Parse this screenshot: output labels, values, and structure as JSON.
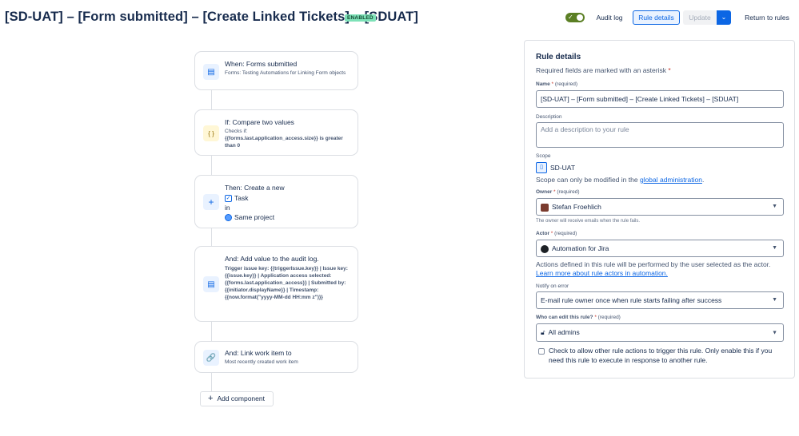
{
  "header": {
    "title": "[SD-UAT] – [Form submitted] – [Create Linked Tickets] – [SDUAT]",
    "status_badge": "ENABLED",
    "audit_log_label": "Audit log",
    "rule_details_label": "Rule details",
    "update_label": "Update",
    "return_label": "Return to rules"
  },
  "flow": {
    "trigger": {
      "title": "When: Forms submitted",
      "subtitle": "Forms: Testing Automations for Linking Form objects"
    },
    "condition": {
      "title": "If: Compare two values",
      "subtitle_prefix": "Checks if:",
      "subtitle_detail": "{{forms.last.application_access.size}} is greater than 0"
    },
    "action_create": {
      "title": "Then: Create a new",
      "issue_type": "Task",
      "in_label": "in",
      "project": "Same project"
    },
    "action_audit": {
      "title": "And: Add value to the audit log.",
      "detail": "Trigger issue key: {{triggerIssue.key}} | Issue key: {{issue.key}} | Application access selected: {{forms.last.application_access}} | Submitted by: {{initiator.displayName}} | Timestamp: {{now.format(\"yyyy-MM-dd HH:mm z\")}}"
    },
    "action_link": {
      "title": "And: Link work item to",
      "subtitle": "Most recently created work item"
    },
    "add_component_label": "Add component"
  },
  "panel": {
    "title": "Rule details",
    "required_note": "Required fields are marked with an asterisk",
    "required_star": "*",
    "name": {
      "label": "Name",
      "required": "(required)",
      "value": "[SD-UAT] – [Form submitted] – [Create Linked Tickets] – [SDUAT]"
    },
    "description": {
      "label": "Description",
      "placeholder": "Add a description to your rule"
    },
    "scope": {
      "label": "Scope",
      "value": "SD-UAT",
      "note_prefix": "Scope can only be modified in the",
      "note_link": "global administration",
      "note_suffix": "."
    },
    "owner": {
      "label": "Owner",
      "required": "(required)",
      "value": "Stefan Froehlich",
      "helper": "The owner will receive emails when the rule fails."
    },
    "actor": {
      "label": "Actor",
      "required": "(required)",
      "value": "Automation for Jira",
      "note_line1": "Actions defined in this rule will be performed by the user selected as the actor.",
      "note_link": "Learn more about rule actors in automation."
    },
    "notify": {
      "label": "Notify on error",
      "value": "E-mail rule owner once when rule starts failing after success"
    },
    "who_can_edit": {
      "label": "Who can edit this rule?",
      "required": "(required)",
      "value": "All admins"
    },
    "allow_trigger_text": "Check to allow other rule actions to trigger this rule. Only enable this if you need this rule to execute in response to another rule."
  },
  "colors": {
    "accent": "#0c66e4",
    "enabled_badge": "#7ee2b8",
    "toggle_on": "#5b7f24",
    "border": "#dcdfe4"
  }
}
